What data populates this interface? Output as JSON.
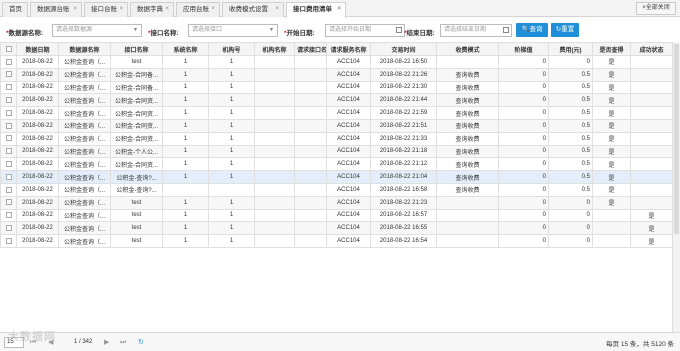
{
  "tabs": [
    {
      "label": "首页",
      "closable": false
    },
    {
      "label": "数据源台账",
      "closable": true
    },
    {
      "label": "接口台账",
      "closable": true
    },
    {
      "label": "数据字典",
      "closable": true
    },
    {
      "label": "应用台账",
      "closable": true
    },
    {
      "label": "收费模式设置",
      "closable": true
    },
    {
      "label": "接口费用清单",
      "closable": true,
      "active": true
    }
  ],
  "close_all_label": "全部关闭",
  "close_glyph": "×",
  "filters": {
    "source_label": "数据源名称:",
    "source_placeholder": "请选择数据源",
    "api_label": "接口名称:",
    "api_placeholder": "请选择接口",
    "start_label": "开始日期:",
    "start_placeholder": "请选择开始日期",
    "end_label": "结束日期:",
    "end_placeholder": "请选择结束日期",
    "required_mark": "*",
    "dropdown_glyph": "▼"
  },
  "buttons": {
    "query": "查询",
    "reset": "重置",
    "query_icon": "🔍",
    "reset_icon": "↻"
  },
  "columns": [
    "",
    "数据日期",
    "数据源名称",
    "接口名称",
    "系统名称",
    "机构号",
    "机构名称",
    "请求接口名",
    "请求服务名称",
    "交易时间",
    "收费模式",
    "阶梯值",
    "费用(元)",
    "是否查得",
    "成功状态"
  ],
  "rows": [
    [
      "2018-08-22",
      "公积金查询（...",
      "test",
      "1",
      "1",
      "",
      "",
      "ACC104",
      "2018-08-22 16:50",
      "",
      "0",
      "0",
      "是",
      ""
    ],
    [
      "2018-08-22",
      "公积金查询（...",
      "公积金-合同备...",
      "1",
      "1",
      "",
      "",
      "ACC104",
      "2018-08-22 21:26",
      "查询收费",
      "0",
      "0.5",
      "是",
      ""
    ],
    [
      "2018-08-22",
      "公积金查询（...",
      "公积金-合同备...",
      "1",
      "1",
      "",
      "",
      "ACC104",
      "2018-08-22 21:30",
      "查询收费",
      "0",
      "0.5",
      "是",
      ""
    ],
    [
      "2018-08-22",
      "公积金查询（...",
      "公积金-合同资...",
      "1",
      "1",
      "",
      "",
      "ACC104",
      "2018-08-22 21:44",
      "查询收费",
      "0",
      "0.5",
      "是",
      ""
    ],
    [
      "2018-08-22",
      "公积金查询（...",
      "公积金-合同资...",
      "1",
      "1",
      "",
      "",
      "ACC104",
      "2018-08-22 21:59",
      "查询收费",
      "0",
      "0.5",
      "是",
      ""
    ],
    [
      "2018-08-22",
      "公积金查询（...",
      "公积金-合同资...",
      "1",
      "1",
      "",
      "",
      "ACC104",
      "2018-08-22 21:51",
      "查询收费",
      "0",
      "0.5",
      "是",
      ""
    ],
    [
      "2018-08-22",
      "公积金查询（...",
      "公积金-合同资...",
      "1",
      "1",
      "",
      "",
      "ACC104",
      "2018-08-22 21:33",
      "查询收费",
      "0",
      "0.5",
      "是",
      ""
    ],
    [
      "2018-08-22",
      "公积金查询（...",
      "公积金-个人公...",
      "1",
      "1",
      "",
      "",
      "ACC104",
      "2018-08-22 21:18",
      "查询收费",
      "0",
      "0.5",
      "是",
      ""
    ],
    [
      "2018-08-22",
      "公积金查询（...",
      "公积金-合同资...",
      "1",
      "1",
      "",
      "",
      "ACC104",
      "2018-08-22 21:12",
      "查询收费",
      "0",
      "0.5",
      "是",
      ""
    ],
    [
      "2018-08-22",
      "公积金查询（...",
      "公积金-查询?...",
      "1",
      "1",
      "",
      "",
      "ACC104",
      "2018-08-22 21:04",
      "查询收费",
      "0",
      "0.5",
      "是",
      ""
    ],
    [
      "2018-08-22",
      "公积金查询（...",
      "公积金-查询?...",
      "",
      "",
      "",
      "",
      "ACC104",
      "2018-08-22 16:58",
      "查询收费",
      "0",
      "0.5",
      "是",
      ""
    ],
    [
      "2018-08-22",
      "公积金查询（...",
      "test",
      "1",
      "1",
      "",
      "",
      "ACC104",
      "2018-08-22 21:23",
      "",
      "0",
      "0",
      "是",
      ""
    ],
    [
      "2018-08-22",
      "公积金查询（...",
      "test",
      "1",
      "1",
      "",
      "",
      "ACC104",
      "2018-08-22 16:57",
      "",
      "0",
      "0",
      "",
      "是"
    ],
    [
      "2018-08-22",
      "公积金查询（...",
      "test",
      "1",
      "1",
      "",
      "",
      "ACC104",
      "2018-08-22 16:55",
      "",
      "0",
      "0",
      "",
      "是"
    ],
    [
      "2018-08-22",
      "公积金查询（...",
      "test",
      "1",
      "1",
      "",
      "",
      "ACC104",
      "2018-08-22 16:54",
      "",
      "0",
      "0",
      "",
      "是"
    ]
  ],
  "selected_row_index": 9,
  "pager": {
    "page_size": "15",
    "page_info": "1 / 342",
    "summary": "每页 15 条，共 5120 条",
    "first_glyph": "⏮",
    "prev_glyph": "◀",
    "next_glyph": "▶",
    "last_glyph": "⏭",
    "refresh_glyph": "↻"
  },
  "watermark": "大数据网",
  "colors": {
    "primary": "#1e8fd8",
    "required": "#e02020",
    "selected_row": "#e3eefa"
  }
}
